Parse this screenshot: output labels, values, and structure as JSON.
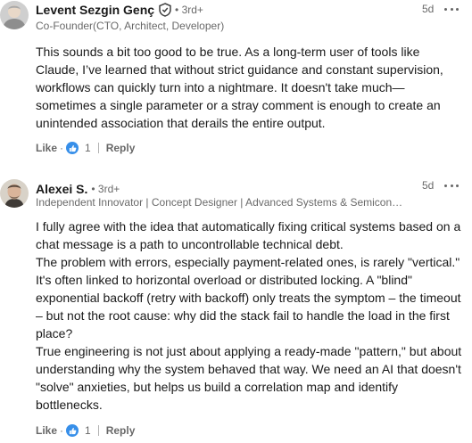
{
  "comments": [
    {
      "author": "Levent Sezgin Genç",
      "verified": true,
      "degree": "• 3rd+",
      "headline": "Co-Founder(CTO, Architect, Developer)",
      "time": "5d",
      "paragraphs": [
        "This sounds a bit too good to be true. As a long-term user of tools like Claude, I’ve learned that without strict guidance and constant supervision, workflows can quickly turn into a nightmare. It doesn't take much—sometimes a single parameter or a stray comment is enough to create an unintended association that derails the entire output."
      ],
      "like_label": "Like",
      "reaction_count": "1",
      "reply_label": "Reply",
      "avatar_icon": "person-avatar-gray",
      "reaction_icon": "thumbs-up-icon"
    },
    {
      "author": "Alexei S.",
      "verified": false,
      "degree": "• 3rd+",
      "headline": "Independent Innovator | Concept Designer | Advanced Systems & Semicond...",
      "time": "5d",
      "paragraphs": [
        "I fully agree with the idea that automatically fixing critical systems based on a chat message is a path to uncontrollable technical debt.",
        "The problem with errors, especially payment-related ones, is rarely \"vertical.\" It's often linked to horizontal overload or distributed locking. A \"blind\" exponential backoff (retry with backoff) only treats the symptom – the timeout – but not the root cause: why did the stack fail to handle the load in the first place?",
        "True engineering is not just about applying a ready-made \"pattern,\" but about understanding why the system behaved that way. We need an AI that doesn't \"solve\" anxieties, but helps us build a correlation map and identify bottlenecks."
      ],
      "like_label": "Like",
      "reaction_count": "1",
      "reply_label": "Reply",
      "avatar_icon": "person-avatar-photo",
      "reaction_icon": "thumbs-up-icon"
    }
  ],
  "colors": {
    "reaction_blue": "#378fe9",
    "text_primary": "#191919",
    "text_secondary": "#666666"
  }
}
